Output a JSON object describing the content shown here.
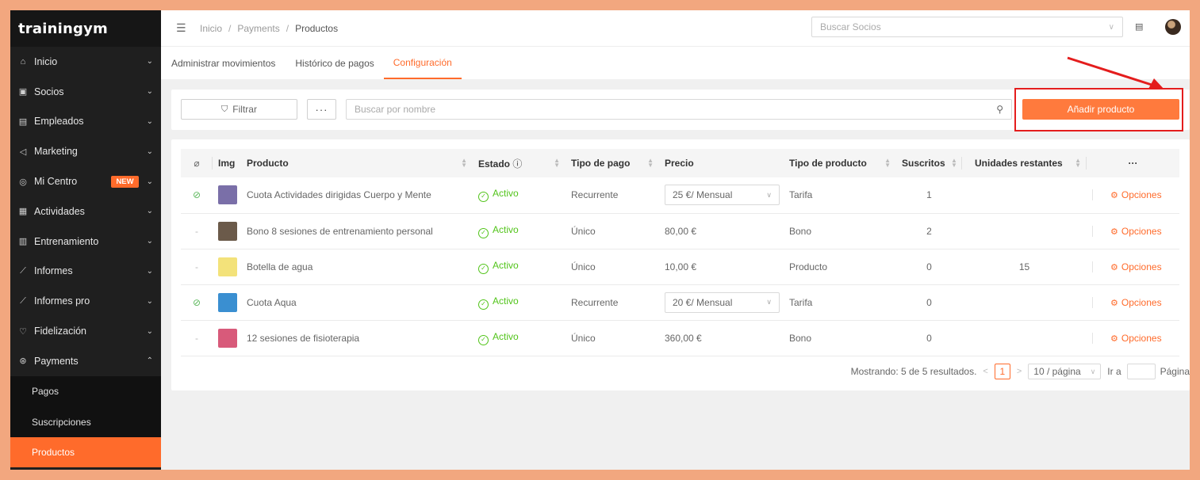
{
  "app": {
    "logo": "trainingym"
  },
  "sidebar": {
    "items": [
      {
        "label": "Inicio",
        "icon": "home-icon",
        "glyph": "⌂"
      },
      {
        "label": "Socios",
        "icon": "member-card-icon",
        "glyph": "▣"
      },
      {
        "label": "Empleados",
        "icon": "employee-card-icon",
        "glyph": "▤"
      },
      {
        "label": "Marketing",
        "icon": "megaphone-icon",
        "glyph": "◁"
      },
      {
        "label": "Mi Centro",
        "icon": "location-icon",
        "glyph": "◎",
        "badge": "NEW"
      },
      {
        "label": "Actividades",
        "icon": "calendar-icon",
        "glyph": "▦"
      },
      {
        "label": "Entrenamiento",
        "icon": "clipboard-icon",
        "glyph": "▥"
      },
      {
        "label": "Informes",
        "icon": "chart-line-icon",
        "glyph": "⟋"
      },
      {
        "label": "Informes pro",
        "icon": "chart-line-icon",
        "glyph": "⟋"
      },
      {
        "label": "Fidelización",
        "icon": "heart-icon",
        "glyph": "♡"
      },
      {
        "label": "Payments",
        "icon": "dollar-icon",
        "glyph": "⊛"
      }
    ],
    "subitems": [
      {
        "label": "Pagos"
      },
      {
        "label": "Suscripciones"
      },
      {
        "label": "Productos"
      }
    ]
  },
  "breadcrumb": {
    "items": [
      "Inicio",
      "Payments",
      "Productos"
    ],
    "separator": "/"
  },
  "header": {
    "search_placeholder": "Buscar Socios"
  },
  "tabs": [
    "Administrar movimientos",
    "Histórico de pagos",
    "Configuración"
  ],
  "toolbar": {
    "filter_label": "Filtrar",
    "more_label": "···",
    "search_placeholder": "Buscar por nombre",
    "add_label": "Añadir producto"
  },
  "table": {
    "headers": {
      "img": "Img",
      "producto": "Producto",
      "estado": "Estado",
      "tipo_pago": "Tipo de pago",
      "precio": "Precio",
      "tipo_producto": "Tipo de producto",
      "suscritos": "Suscritos",
      "unidades": "Unidades restantes",
      "more": "···"
    },
    "rows": [
      {
        "linked": true,
        "producto": "Cuota Actividades dirigidas Cuerpo y Mente",
        "estado": "Activo",
        "tipo_pago": "Recurrente",
        "precio": "25 €/ Mensual",
        "precio_select": true,
        "tipo_producto": "Tarifa",
        "suscritos": "1",
        "unidades": "",
        "opciones": "Opciones",
        "thumb": "#7a6fa8"
      },
      {
        "linked": false,
        "producto": "Bono 8 sesiones de entrenamiento personal",
        "estado": "Activo",
        "tipo_pago": "Único",
        "precio": "80,00 €",
        "precio_select": false,
        "tipo_producto": "Bono",
        "suscritos": "2",
        "unidades": "",
        "opciones": "Opciones",
        "thumb": "#6b5a4a"
      },
      {
        "linked": false,
        "producto": "Botella de agua",
        "estado": "Activo",
        "tipo_pago": "Único",
        "precio": "10,00 €",
        "precio_select": false,
        "tipo_producto": "Producto",
        "suscritos": "0",
        "unidades": "15",
        "opciones": "Opciones",
        "thumb": "#f3e27a"
      },
      {
        "linked": true,
        "producto": "Cuota Aqua",
        "estado": "Activo",
        "tipo_pago": "Recurrente",
        "precio": "20 €/ Mensual",
        "precio_select": true,
        "tipo_producto": "Tarifa",
        "suscritos": "0",
        "unidades": "",
        "opciones": "Opciones",
        "thumb": "#3a8fd1"
      },
      {
        "linked": false,
        "producto": "12 sesiones de fisioterapia",
        "estado": "Activo",
        "tipo_pago": "Único",
        "precio": "360,00 €",
        "precio_select": false,
        "tipo_producto": "Bono",
        "suscritos": "0",
        "unidades": "",
        "opciones": "Opciones",
        "thumb": "#d85a7a"
      }
    ]
  },
  "pagination": {
    "summary": "Mostrando: 5 de 5 resultados.",
    "current_page": "1",
    "page_size": "10 / página",
    "goto_label": "Ir a",
    "page_label": "Página"
  },
  "colors": {
    "accent": "#ff6b2b",
    "active_green": "#52c41a",
    "highlight_red": "#e41d1d"
  }
}
